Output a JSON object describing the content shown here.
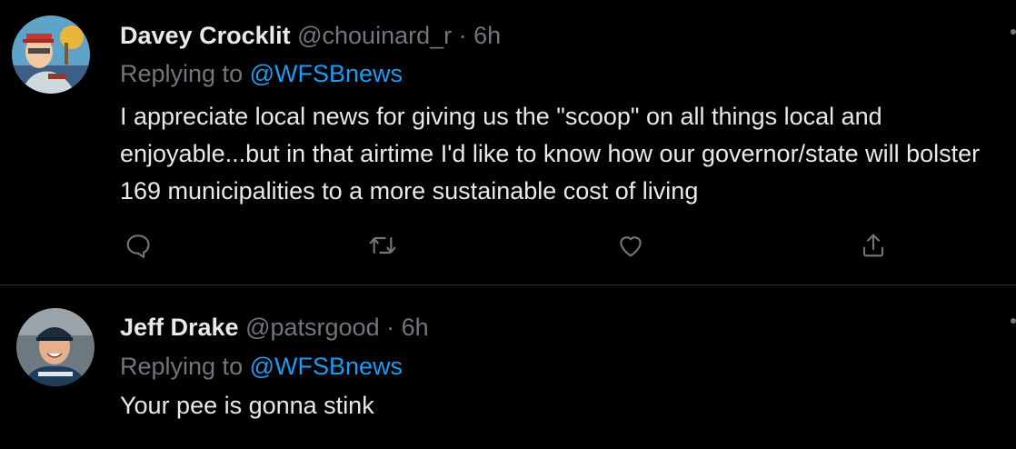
{
  "colors": {
    "background": "#000000",
    "text_primary": "#e7e9ea",
    "text_secondary": "#71767b",
    "mention": "#1d9bf0",
    "divider": "#2f3336"
  },
  "tweets": [
    {
      "display_name": "Davey Crocklit",
      "handle": "@chouinard_r",
      "separator": "·",
      "time": "6h",
      "replying_prefix": "Replying to",
      "replying_to": "@WFSBnews",
      "text": "I appreciate local news for giving us the \"scoop\" on all things local and enjoyable...but in that airtime I'd like to know how our governor/state will bolster 169 municipalities to a more sustainable cost of living",
      "actions": [
        "reply-icon",
        "retweet-icon",
        "like-icon",
        "share-icon"
      ]
    },
    {
      "display_name": "Jeff Drake",
      "handle": "@patsrgood",
      "separator": "·",
      "time": "6h",
      "replying_prefix": "Replying to",
      "replying_to": "@WFSBnews",
      "text": "Your pee is gonna stink"
    }
  ]
}
